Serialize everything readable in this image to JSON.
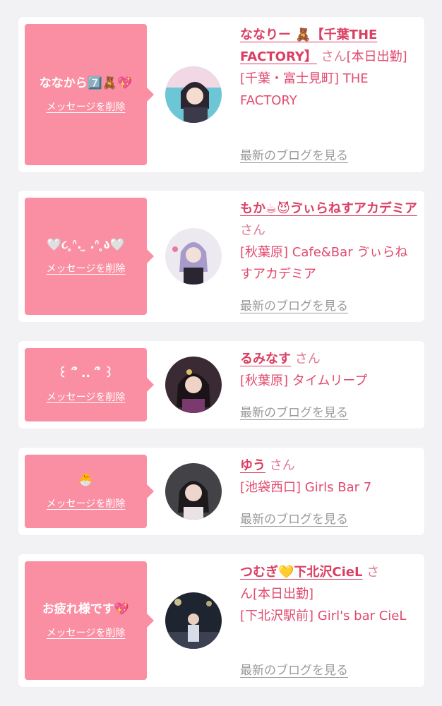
{
  "messages": [
    {
      "text": "ななから7️⃣🧸💖",
      "delete_label": "メッセージを削除",
      "name": "ななりー 🧸【千葉THE FACTORY】",
      "honorific": "さん",
      "status": "[本日出勤]",
      "location": "[千葉・富士見町] THE FACTORY",
      "blog_label": "最新のブログを見る",
      "avatar_color": "#6cc6d6"
    },
    {
      "text": "🤍૮ ̥ᐢ. ̫ .ᐢ ̥ა🤍",
      "delete_label": "メッセージを削除",
      "name": "もか☕😈ゔぃらねすアカデミア",
      "honorific": "さん",
      "status": "",
      "location": "[秋葉原] Cafe&Bar ゔぃらねすアカデミア",
      "blog_label": "最新のブログを見る",
      "avatar_color": "#bfb4d8"
    },
    {
      "text": "꒰ ՞ .. ՞ ꒱",
      "delete_label": "メッセージを削除",
      "name": "るみなす",
      "honorific": "さん",
      "status": "",
      "location": "[秋葉原] タイムリープ",
      "blog_label": "最新のブログを見る",
      "avatar_color": "#3a2a33"
    },
    {
      "text": "🐣",
      "delete_label": "メッセージを削除",
      "name": "ゆう",
      "honorific": "さん",
      "status": "",
      "location": "[池袋西口] Girls Bar 7",
      "blog_label": "最新のブログを見る",
      "avatar_color": "#2a2a2e"
    },
    {
      "text": "お疲れ様です💖",
      "delete_label": "メッセージを削除",
      "name": "つむぎ💛下北沢CieL",
      "honorific": "さ",
      "status": "ん[本日出勤]",
      "location": "[下北沢駅前] Girl's bar CieL",
      "blog_label": "最新のブログを見る",
      "avatar_color": "#1e2430"
    }
  ]
}
